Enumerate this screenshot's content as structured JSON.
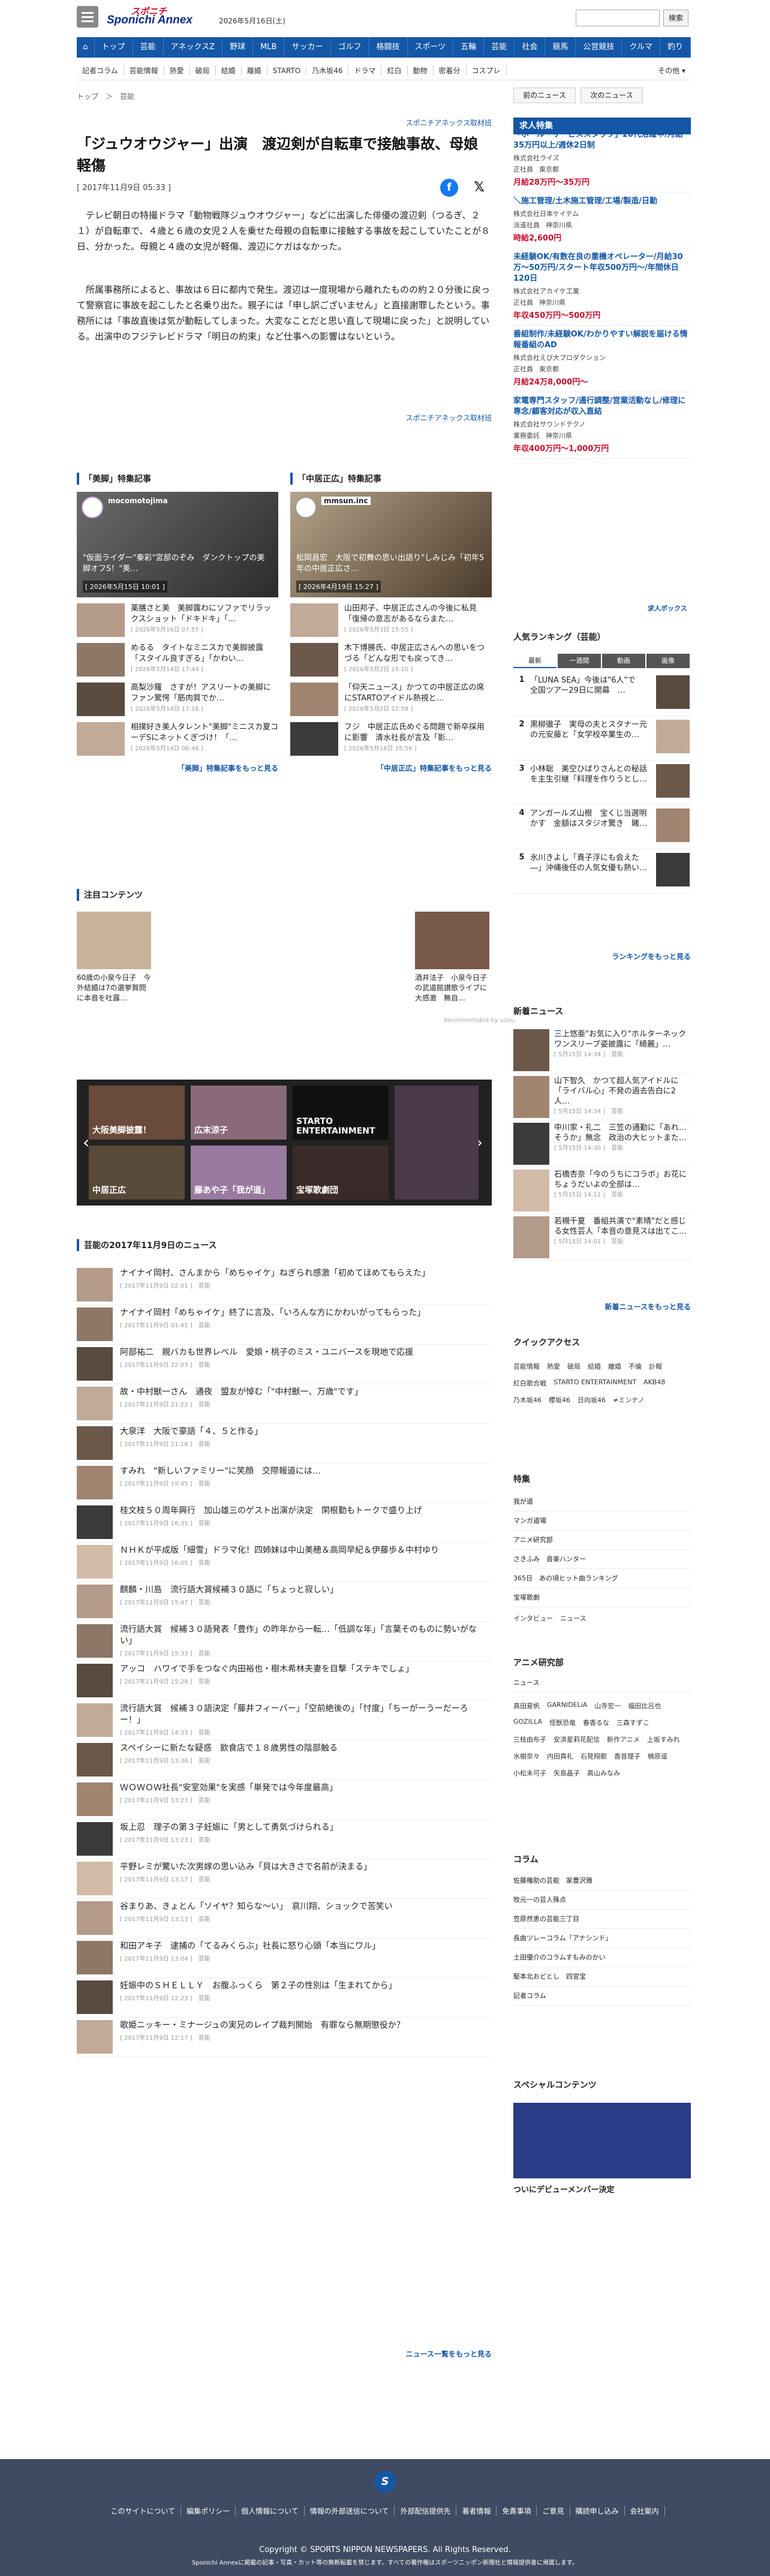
{
  "header": {
    "date": "2026年5月16日(土)",
    "search_button": "検索"
  },
  "nav": [
    "トップ",
    "芸能",
    "アネックスZ",
    "野球",
    "MLB",
    "サッカー",
    "ゴルフ",
    "格闘技",
    "スポーツ",
    "五輪",
    "芸能",
    "社会",
    "競馬",
    "公営競技",
    "クルマ",
    "釣り"
  ],
  "subnav": [
    "記者コラム",
    "芸能情報",
    "熱愛",
    "破局",
    "結婚",
    "離婚",
    "STARTO",
    "乃木坂46",
    "ドラマ",
    "紅白",
    "動物",
    "密着分",
    "コスプレ"
  ],
  "subnav_more": "その他 ▾",
  "breadcrumb": "トップ　＞　芸能",
  "prev_label": "前のニュース",
  "next_label": "次のニュース",
  "article": {
    "pr_label": "スポニチアネックス取材班",
    "title": "「ジュウオウジャー」出演　渡辺剣が自転車で接触事故、母娘軽傷",
    "date": "[ 2017年11月9日 05:33 ]",
    "p1": "　テレビ朝日の特撮ドラマ「動物戦隊ジュウオウジャー」などに出演した俳優の渡辺剣（つるぎ、２１）が自転車で、４歳と６歳の女児２人を乗せた母親の自転車に接触する事故を起こしていたことが８日、分かった。母親と４歳の女児が軽傷、渡辺にケガはなかった。",
    "p2": "　所属事務所によると、事故は６日に都内で発生。渡辺は一度現場から離れたものの約２０分後に戻って警察官に事故を起こしたと名乗り出た。親子には「申し訳ございません」と直接謝罪したという。事務所には「事故直後は気が動転してしまった。大変なことだと思い直して現場に戻った」と説明している。出演中のフジテレビドラマ「明日の約束」など仕事への影響はないという。",
    "pr_link": "スポニチアネックス取材班"
  },
  "feature_left": {
    "heading": "「美脚」特集記事",
    "hero_account": "mocomotojima",
    "hero_caption": "\"仮面ライダー\"秦彩\"宮部のぞみ　ダンクトップの美脚オフS！\"美…",
    "hero_date": "[ 2026年5月15日 10:01 ]",
    "items": [
      {
        "t": "薬膳さと美　美脚露わにソファでリラックスショット「ドキドキ」「…",
        "d": "[ 2026年5月16日 07:57 ]"
      },
      {
        "t": "めるる　タイトなミニスカで美脚披露「スタイル良すぎる」「かわい…",
        "d": "[ 2026年5月14日 17:44 ]"
      },
      {
        "t": "高梨沙羅　さすが！アスリートの美脚にファン驚愕「筋肉質でか…",
        "d": "[ 2026年5月14日 17:16 ]"
      },
      {
        "t": "相撲好き美人タレント\"美脚\"ミニスカ夏コーデSにネットくぎづけ！「…",
        "d": "[ 2026年5月14日 06:46 ]"
      }
    ],
    "more": "「美脚」特集記事をもっと見る"
  },
  "feature_right": {
    "heading": "「中居正広」特集記事",
    "hero_account": "mmsun.inc",
    "hero_caption": "松岡昌宏　大阪で初舞の思い出語り\"しみじみ「初年5年の中居正広さ…",
    "hero_date": "[ 2026年4月19日 15:27 ]",
    "items": [
      {
        "t": "山田邦子、中居正広さんの今後に私見「復帰の意志があるならまた…",
        "d": "[ 2026年5月3日 15:55 ]"
      },
      {
        "t": "木下博勝氏、中居正広さんへの思いをつづる「どんな形でも戻ってき…",
        "d": "[ 2026年5月2日 15:10 ]"
      },
      {
        "t": "「仰天ニュース」かつての中居正広の席にSTARTOアイドル熱視と…",
        "d": "[ 2026年5月2日 22:58 ]"
      },
      {
        "t": "フジ　中居正広氏めぐる問題で新卒採用に影響　清水社長が言及「影…",
        "d": "[ 2026年5月16日 15:56 ]"
      }
    ],
    "more": "「中居正広」特集記事をもっと見る"
  },
  "attention": {
    "heading": "注目コンテンツ",
    "items": [
      {
        "t": "60歳の小泉今日子　今外結婚は7の選挙賀問に本音を吐露…"
      },
      {
        "t": "酒井法子　小泉今日子の武道館讃歌ライブに大感激　無自…"
      }
    ],
    "recommended": "Recommended by uzou"
  },
  "carousel": [
    {
      "label": "大阪美脚披露！"
    },
    {
      "label": "広末涼子"
    },
    {
      "label": "STARTO ENTERTAINMENT"
    },
    {
      "label": "中居正広"
    },
    {
      "label": "藤あや子「我が道」"
    },
    {
      "label": "宝塚歌劇団"
    }
  ],
  "news_heading": "芸能の2017年11月9日のニュース",
  "news": [
    {
      "t": "ナイナイ岡村、さんまから「めちゃイケ」ねぎられ感激「初めてほめてもらえた」",
      "d": "[ 2017年11月9日 02:01 ]　芸能"
    },
    {
      "t": "ナイナイ岡村「めちゃイケ」終了に言及、「いろんな方にかわいがってもらった」",
      "d": "[ 2017年11月9日 01:41 ]　芸能"
    },
    {
      "t": "阿部祐二　親バカも世界レベル　愛娘・桃子のミス・ユニバースを現地で応援",
      "d": "[ 2017年11月9日 22:03 ]　芸能"
    },
    {
      "t": "故・中村獣一さん　通夜　盟友が悼む「\"中村獣一、万歳\"です」",
      "d": "[ 2017年11月9日 21:22 ]　芸能"
    },
    {
      "t": "大泉洋　大阪で豪語「４、５と作る」",
      "d": "[ 2017年11月9日 21:16 ]　芸能"
    },
    {
      "t": "すみれ　\"新しいファミリー\"に笑顔　交際報道には…",
      "d": "[ 2017年11月9日 19:45 ]　芸能"
    },
    {
      "t": "桂文枝５０周年興行　加山雄三のゲスト出演が決定　閑根勤もトークで盛り上げ",
      "d": "[ 2017年11月9日 16:35 ]　芸能"
    },
    {
      "t": "ＮＨＫが平成版「細雪」ドラマ化！四姉妹は中山美穂＆高岡早紀＆伊藤歩＆中村ゆり",
      "d": "[ 2017年11月9日 16:05 ]　芸能"
    },
    {
      "t": "麒麟・川島　流行語大賞候補３０語に「ちょっと寂しい」",
      "d": "[ 2017年11月9日 15:47 ]　芸能"
    },
    {
      "t": "流行語大賞　候補３０語発表「豊作」の昨年から一転…「低調な年」「言葉そのものに勢いがない」",
      "d": "[ 2017年11月9日 15:33 ]　芸能"
    },
    {
      "t": "アッコ　ハワイで手をつなぐ内田裕也・樹木希林夫妻を目撃「ステキでしょ」",
      "d": "[ 2017年11月9日 15:28 ]　芸能"
    },
    {
      "t": "流行語大賞　候補３０語決定「藤井フィーバー」「空前絶後の」「忖度」「ちーがーうーだーろー！」",
      "d": "[ 2017年11月9日 14:33 ]　芸能"
    },
    {
      "t": "スペイシーに新たな疑惑　飲食店で１８歳男性の陰部触る",
      "d": "[ 2017年11月9日 13:36 ]　芸能"
    },
    {
      "t": "ＷＯＷＯＷ社長\"安室効果\"を実感「単発では今年度最高」",
      "d": "[ 2017年11月9日 13:23 ]　芸能"
    },
    {
      "t": "坂上忍　理子の第３子妊娠に「男として勇気づけられる」",
      "d": "[ 2017年11月9日 13:23 ]　芸能"
    },
    {
      "t": "平野レミが驚いた次男嫁の思い込み「貝は大きさで名前が決まる」",
      "d": "[ 2017年11月9日 13:17 ]　芸能"
    },
    {
      "t": "谷まりあ、きょとん「ソイヤ？知らな〜い」　哀川翔、ショックで苦笑い",
      "d": "[ 2017年11月9日 13:13 ]　芸能"
    },
    {
      "t": "和田アキ子　逮捕の「てるみくらぶ」社長に怒り心頭「本当にワル」",
      "d": "[ 2017年11月9日 13:04 ]　芸能"
    },
    {
      "t": "妊娠中のＳＨＥＬＬＹ　お腹ふっくら　第２子の性別は「生まれてから」",
      "d": "[ 2017年11月9日 12:23 ]　芸能"
    },
    {
      "t": "歌姫ニッキー・ミナージュの実兄のレイプ裁判開始　有罪なら無期懲役か？",
      "d": "[ 2017年11月9日 12:17 ]　芸能"
    }
  ],
  "news_more": "ニュース一覧をもっと見る",
  "jobs": {
    "heading": "求人特集",
    "items": [
      {
        "t": "「ホール・サービススタッフ」20代活躍中/月給35万円以上/週休2日制",
        "c": "株式会社ライズ",
        "p": "正社員",
        "l": "東京都",
        "s": "月給28万円〜35万円"
      },
      {
        "t": "＼施工管理/土木施工管理/工場/製造/日勤",
        "c": "株式会社日本ケイテム",
        "p": "派遣社員",
        "l": "神奈川県",
        "s": "時給2,600円"
      },
      {
        "t": "未経験OK/有数在良の重機オペレータ一/月給30万〜50万円/スタート年収500万円〜/年間休日120日",
        "c": "株式会社アカイケ工業",
        "p": "正社員",
        "l": "神奈川県",
        "s": "年収450万円〜500万円"
      },
      {
        "t": "番組制作/未経験OK/わかりやすい解説を届ける情報番組のAD",
        "c": "株式会社えび大プロダクション",
        "p": "正社員",
        "l": "東京都",
        "s": "月給24万8,000円〜"
      },
      {
        "t": "家電専門スタッフ/通行調整/営業活動なし/修理に専念/顧客対応が収入直結",
        "c": "株式会社サウンドテクノ",
        "p": "業務委託",
        "l": "神奈川県",
        "s": "年収400万円〜1,000万円"
      }
    ],
    "logo": "求人ボックス"
  },
  "ranking": {
    "heading": "人気ランキング（芸能）",
    "tabs": [
      "最新",
      "一週間",
      "動画",
      "画像"
    ],
    "items": [
      {
        "n": "1",
        "t": "「LUNA SEA」今後は\"6人\"で　全国ツアー29日に開幕　…"
      },
      {
        "n": "2",
        "t": "黒柳徹子　実母の夫とスタナー元の元安藤と「女学校卒業生の…"
      },
      {
        "n": "3",
        "t": "小林聡　美空ひばりさんとの秘話を主生引継「料理を作りうとし…"
      },
      {
        "n": "4",
        "t": "アンガールズ山根　宝くじ当選明かす　金額はスタジオ驚き　賭…"
      },
      {
        "n": "5",
        "t": "氷川きよし「貴子浮にも会えた―」沖縄後任の人気女優も熱い…"
      }
    ],
    "more": "ランキングをもっと見る"
  },
  "newnews": {
    "heading": "新着ニュース",
    "items": [
      {
        "t": "三上悠亜\"お気に入り\"ホルターネックワンスリーブ姿披露に「綺麗」…",
        "d": "[ 5月15日 14:34 ]　芸能"
      },
      {
        "t": "山下智久　かつて超人気アイドルに「ライバル心」不発の過去告白に2人…",
        "d": "[ 5月15日 14:34 ]　芸能"
      },
      {
        "t": "中川家・礼二　三笠の通勤に「あれ…そうか」無念　政治の大ヒットまた…",
        "d": "[ 5月15日 14:30 ]　芸能"
      },
      {
        "t": "石橋杏奈「今のうちにコラボ」お花にちょうだいよの全部は…",
        "d": "[ 5月15日 14:11 ]　芸能"
      },
      {
        "t": "若槻千夏　番組共演で\"素晴\"だと感じる女性芸人「本音の意見スは出てこ…",
        "d": "[ 5月15日 14:01 ]　芸能"
      }
    ],
    "more": "新着ニュースをもっと見る"
  },
  "quick": {
    "heading": "クイックアクセス",
    "tags": [
      "芸能情報",
      "熱愛",
      "破局",
      "結婚",
      "離婚",
      "不倫",
      "訃報",
      "紅白歌合戦",
      "STARTO ENTERTAINMENT",
      "AKB48",
      "乃木坂46",
      "櫻坂46",
      "日向坂46",
      "≠ミンナノ"
    ]
  },
  "tokushu": {
    "heading": "特集",
    "items": [
      "我が道",
      "マンガ道場",
      "アニメ研究部",
      "さきふみ　音楽ハンター",
      "365日　あの頃ヒット曲ランキング",
      "宝塚歌劇"
    ],
    "tags": [
      "インタビュー",
      "ニュース"
    ]
  },
  "anime": {
    "heading": "アニメ研究部",
    "sub": "ニュース",
    "tags": [
      "高田夏帆",
      "GARNIDELiA",
      "山寺宏一",
      "福田比呂也",
      "GOZILLA",
      "怪獣恐竜",
      "春香るな",
      "三森すずこ",
      "三枝由布子",
      "安済星莉花配信",
      "新作アニメ",
      "上坂すみれ",
      "水樹奈々",
      "内田真礼",
      "石見翔歌",
      "香音理子",
      "楠原遥",
      "小松未可子",
      "矢島晶子",
      "高山みなみ"
    ]
  },
  "column": {
    "heading": "コラム",
    "items": [
      "佐藤権助の芸能　家豊沢雅",
      "牧元一の芸人殊点",
      "笠原然恵の芸能三丁目",
      "長曲ツレーコラム「アナシンド」",
      "土田優介のコラムすもみのかい",
      "駆本北おどとし　四宮宝",
      "記者コラム"
    ]
  },
  "special": {
    "heading": "スペシャルコンテンツ",
    "caption": "ついにデビューメンバー決定"
  },
  "footer": {
    "links": [
      "このサイトについて",
      "編集ポリシー",
      "個人情報について",
      "情報の外部送信について",
      "外部配信提供先",
      "著者情報",
      "免責事項",
      "ご意見",
      "購読申し込み",
      "会社案内"
    ],
    "copy": "Copyright © SPORTS NIPPON NEWSPAPERS. All Rights Reserved.",
    "note": "Sponichi Annexに掲載の記事・写真・カット等の無断転載を禁じます。すべての著作権はスポーツニッポン新聞社と情報提供者に帰属します。"
  },
  "colors": {
    "brand": "#1457a6",
    "accent": "#c8102e"
  }
}
